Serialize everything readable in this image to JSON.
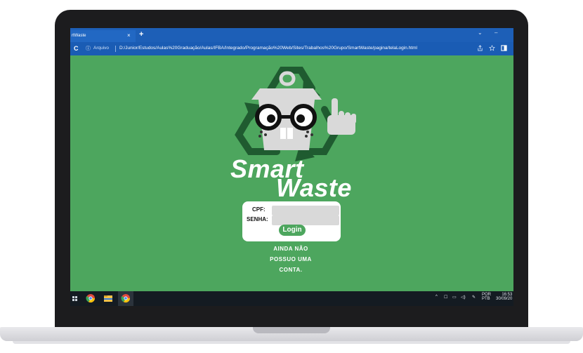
{
  "browser": {
    "tab_title": "rtWaste",
    "tab_close": "×",
    "new_tab": "+",
    "minimize": "–",
    "chevron": "⌄",
    "reload": "C",
    "info": "ⓘ",
    "protocol_label": "Arquivo",
    "url": "D:/Junior/Estudos/Aulas%20Graduação/Aulas/IFBA/Integrado/Programação%20Web/Sites/Trabalhos%20Grupo/SmartWaste/pagina/telaLogin.html"
  },
  "brand": {
    "line1": "Smart",
    "line2": "Waste"
  },
  "login": {
    "cpf_label": "CPF:",
    "senha_label": "SENHA:",
    "cpf_value": "",
    "senha_value": "",
    "button_label": "Login"
  },
  "signup": {
    "line1": "AINDA NÃO",
    "line2": "POSSUO UMA",
    "line3": "CONTA."
  },
  "taskbar": {
    "language_top": "POR",
    "language_bottom": "PTB",
    "time": "16:53",
    "date": "30/09/20"
  },
  "colors": {
    "page_green": "#4da65e",
    "browser_blue": "#1d5fb7",
    "logo_dark_green": "#1f5b30"
  }
}
